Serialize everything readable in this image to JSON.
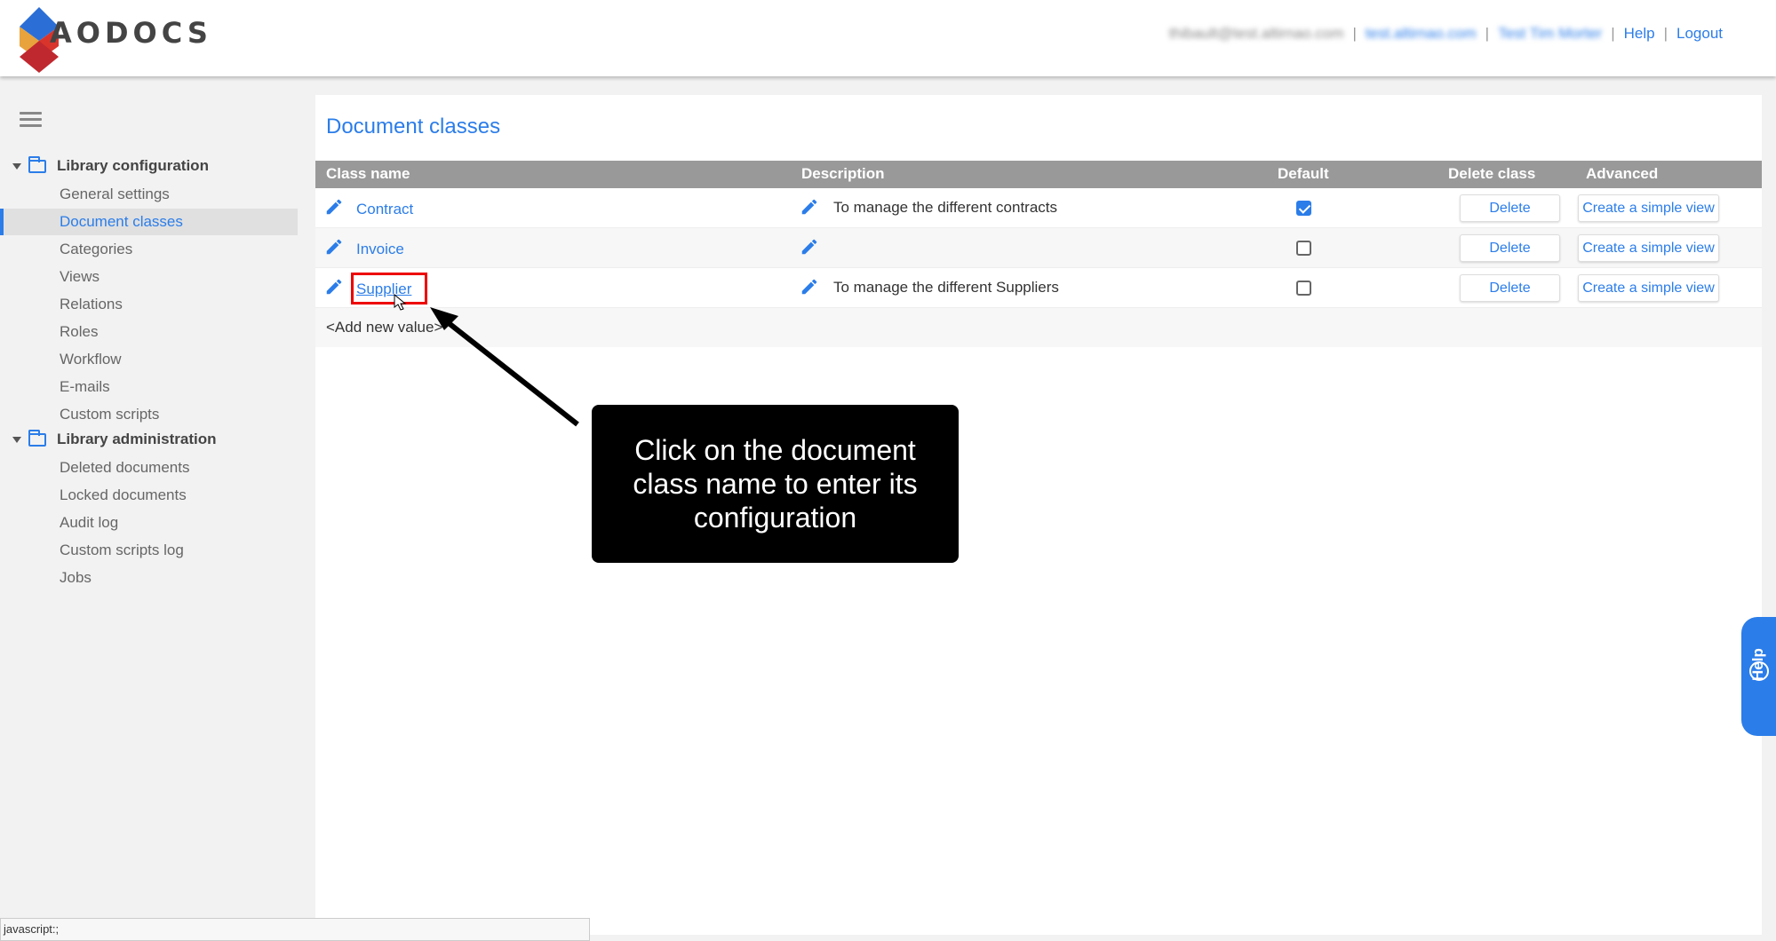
{
  "header": {
    "logo_text": "AODOCS",
    "user_email": "thibault@test.altirnao.com",
    "domain": "test.altirnao.com",
    "library": "Test Tim Morter",
    "help": "Help",
    "logout": "Logout"
  },
  "sidebar": {
    "sections": [
      {
        "title": "Library configuration",
        "items": [
          "General settings",
          "Document classes",
          "Categories",
          "Views",
          "Relations",
          "Roles",
          "Workflow",
          "E-mails",
          "Custom scripts"
        ]
      },
      {
        "title": "Library administration",
        "items": [
          "Deleted documents",
          "Locked documents",
          "Audit log",
          "Custom scripts log",
          "Jobs"
        ]
      }
    ],
    "active_item": "Document classes"
  },
  "main": {
    "title": "Document classes",
    "columns": [
      "Class name",
      "Description",
      "Default",
      "Delete class",
      "Advanced"
    ],
    "rows": [
      {
        "name": "Contract",
        "description": "To manage the different contracts",
        "default": true,
        "delete": "Delete",
        "advanced": "Create a simple view"
      },
      {
        "name": "Invoice",
        "description": "",
        "default": false,
        "delete": "Delete",
        "advanced": "Create a simple view"
      },
      {
        "name": "Supplier",
        "description": "To manage the different Suppliers",
        "default": false,
        "delete": "Delete",
        "advanced": "Create a simple view"
      }
    ],
    "add_new": "<Add new value>"
  },
  "callout": {
    "text_line1": "Click on the document",
    "text_line2": "class name to enter its",
    "text_line3": "configuration"
  },
  "help_tab": "Help",
  "status_bar": "javascript:;",
  "colors": {
    "accent": "#2b7de9",
    "header_row": "#999999",
    "highlight": "#ee0000"
  }
}
